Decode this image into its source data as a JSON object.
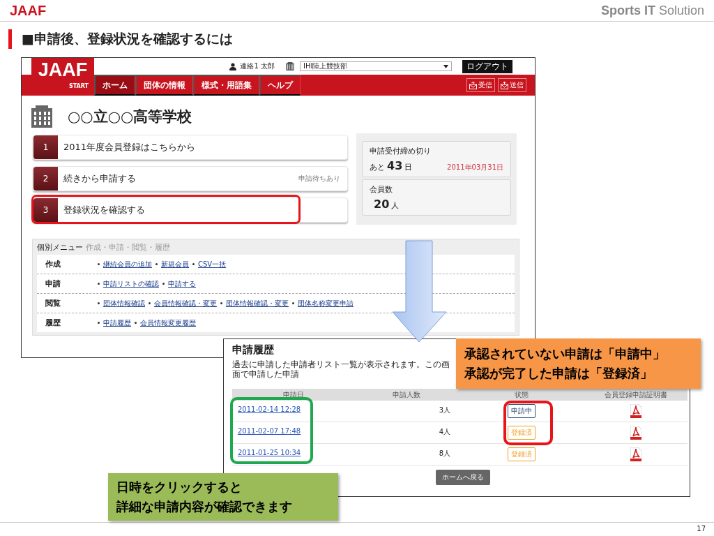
{
  "header": {
    "logo": "JAAF",
    "brand": "**Sports IT** Solution"
  },
  "title": "■申請後、登録状況を確認するには",
  "portal": {
    "logo": "JAAF",
    "logo_sub": "START",
    "user": "連絡1 太郎",
    "organization": "IHI陸上競技部",
    "logout": "ログアウト",
    "nav": [
      {
        "label": "ホーム",
        "selected": true
      },
      {
        "label": "団体の情報",
        "selected": false
      },
      {
        "label": "様式・用語集",
        "selected": false
      },
      {
        "label": "ヘルプ",
        "selected": false
      }
    ],
    "mail_buttons": [
      "受信",
      "送信"
    ],
    "school": "○○立○○高等学校",
    "steps": [
      {
        "number": "1",
        "label": "2011年度会員登録はこちらから",
        "highlighted": false
      },
      {
        "number": "2",
        "label": "続きから申請する",
        "note": "申請待ちあり",
        "highlighted": false
      },
      {
        "number": "3",
        "label": "登録状況を確認する",
        "highlighted": true
      }
    ],
    "deadline": {
      "label": "申請受付締め切り",
      "prefix": "あと",
      "days": "43",
      "unit": "日",
      "date": "2011年03月31日"
    },
    "members": {
      "label": "会員数",
      "count": "20",
      "unit": "人"
    },
    "menu": {
      "title": "個別メニュー",
      "subtitle": "作成・申請・閲覧・履歴",
      "rows": [
        {
          "label": "作成",
          "links": [
            "継続会員の追加",
            "新規会員",
            "CSV一括"
          ]
        },
        {
          "label": "申請",
          "links": [
            "申請リストの確認",
            "申請する"
          ]
        },
        {
          "label": "閲覧",
          "links": [
            "団体情報確認",
            "会員情報確認・変更",
            "団体情報確認・変更",
            "団体名称変更申請"
          ]
        },
        {
          "label": "履歴",
          "links": [
            "申請履歴",
            "会員情報変更履歴"
          ]
        }
      ]
    }
  },
  "history": {
    "title": "申請履歴",
    "description": "過去に申請した申請者リスト一覧が表示されます。この画面で申請した申請",
    "columns": [
      {
        "label": "申請日",
        "highlighted": true,
        "color": "#1fa84f"
      },
      {
        "label": "申請人数",
        "highlighted": false
      },
      {
        "label": "状態",
        "highlighted": true,
        "color": "#e8141b"
      },
      {
        "label": "会員登録申請証明書",
        "highlighted": false
      }
    ],
    "rows": [
      {
        "date": "2011-02-14 12:28",
        "count": "3人",
        "status": {
          "label": "申請中",
          "kind": "pending"
        }
      },
      {
        "date": "2011-02-07 17:48",
        "count": "4人",
        "status": {
          "label": "登録済",
          "kind": "registered"
        }
      },
      {
        "date": "2011-01-25 10:34",
        "count": "8人",
        "status": {
          "label": "登録済",
          "kind": "registered"
        }
      }
    ],
    "back_button": "ホームへ戻る"
  },
  "callouts": [
    {
      "lines": [
        "承認されていない申請は「申請中」",
        "承認が完了した申請は「登録済」"
      ],
      "color": "#f79646"
    },
    {
      "lines": [
        "日時をクリックすると",
        "詳細な申請内容が確認できます"
      ],
      "color": "#9bbb59"
    }
  ],
  "page_number": "17"
}
